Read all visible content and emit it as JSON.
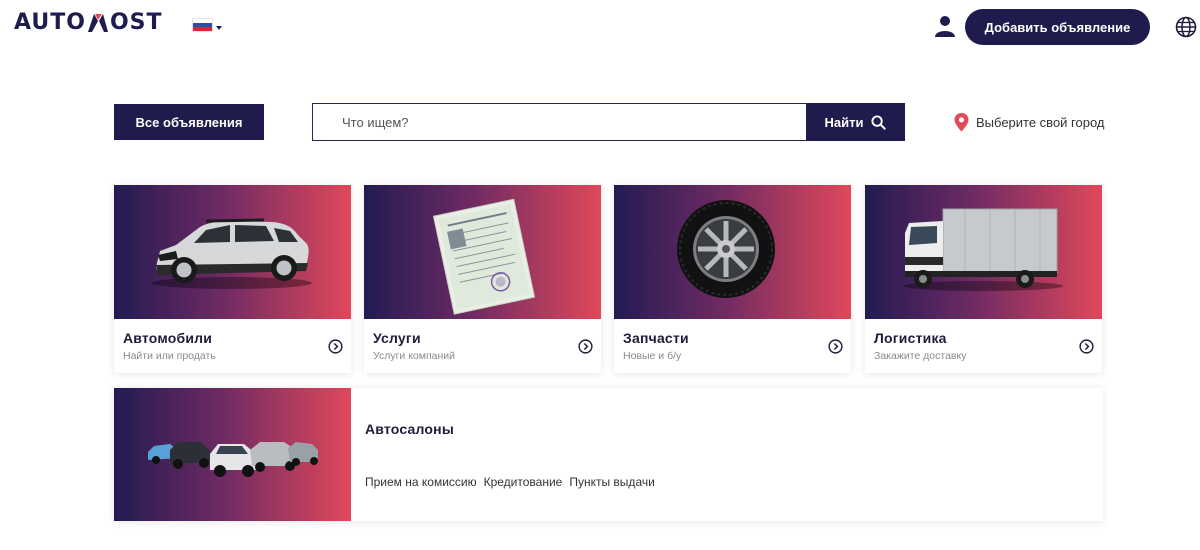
{
  "header": {
    "logo_left": "AUTO",
    "logo_right": "OST",
    "flag": "russia-flag",
    "add_button": "Добавить объявление"
  },
  "search": {
    "all_button": "Все объявления",
    "placeholder": "Что ищем?",
    "value": "",
    "find_button": "Найти",
    "city": "Выберите свой город"
  },
  "categories": [
    {
      "title": "Автомобили",
      "subtitle": "Найти или продать",
      "icon": "car-image"
    },
    {
      "title": "Услуги",
      "subtitle": "Услуги компаний",
      "icon": "document-image"
    },
    {
      "title": "Запчасти",
      "subtitle": "Новые и б/у",
      "icon": "wheel-image"
    },
    {
      "title": "Логистика",
      "subtitle": "Закажите доставку",
      "icon": "truck-image"
    }
  ],
  "dealers": {
    "title": "Автосалоны",
    "links": [
      "Прием на комиссию",
      "Кредитование",
      "Пункты выдачи"
    ]
  },
  "colors": {
    "brand_dark": "#1f1b4d",
    "accent_red": "#e0485a",
    "pin_red": "#e04a5a"
  }
}
